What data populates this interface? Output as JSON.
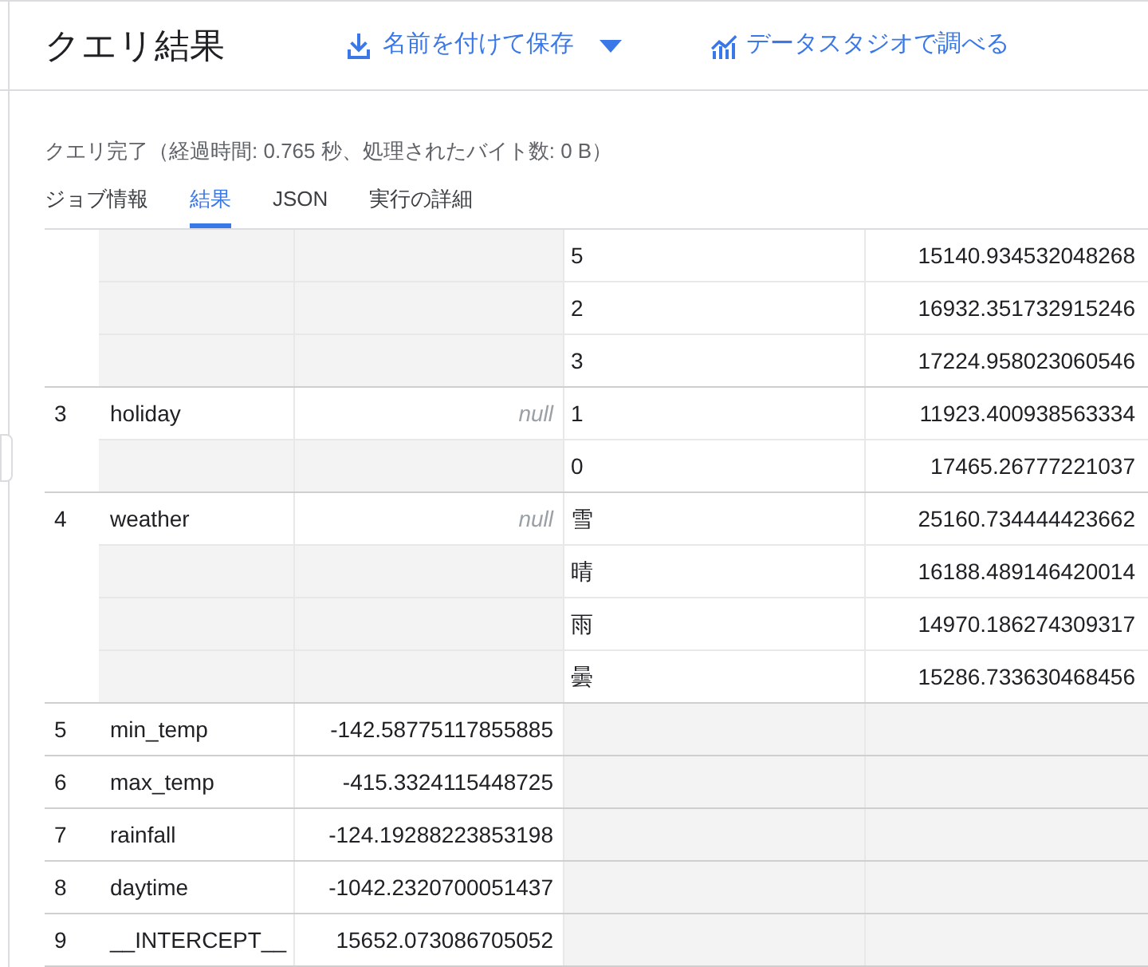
{
  "header": {
    "title": "クエリ結果",
    "save_button": "名前を付けて保存",
    "explore_button": "データスタジオで調べる"
  },
  "status": "クエリ完了（経過時間: 0.765 秒、処理されたバイト数: 0 B）",
  "tabs": [
    {
      "label": "ジョブ情報",
      "selected": false
    },
    {
      "label": "結果",
      "selected": true
    },
    {
      "label": "JSON",
      "selected": false
    },
    {
      "label": "実行の詳細",
      "selected": false
    }
  ],
  "table": {
    "groups": [
      {
        "categories": [
          {
            "category": "5",
            "weight": "15140.934532048268"
          },
          {
            "category": "2",
            "weight": "16932.351732915246"
          },
          {
            "category": "3",
            "weight": "17224.958023060546"
          }
        ]
      },
      {
        "number": "3",
        "name": "holiday",
        "value": "null",
        "value_is_null": true,
        "categories": [
          {
            "category": "1",
            "weight": "11923.400938563334"
          },
          {
            "category": "0",
            "weight": "17465.26777221037"
          }
        ]
      },
      {
        "number": "4",
        "name": "weather",
        "value": "null",
        "value_is_null": true,
        "categories": [
          {
            "category": "雪",
            "weight": "25160.734444423662"
          },
          {
            "category": "晴",
            "weight": "16188.489146420014"
          },
          {
            "category": "雨",
            "weight": "14970.186274309317"
          },
          {
            "category": "曇",
            "weight": "15286.733630468456"
          }
        ]
      },
      {
        "number": "5",
        "name": "min_temp",
        "value": "-142.58775117855885",
        "value_is_null": false
      },
      {
        "number": "6",
        "name": "max_temp",
        "value": "-415.3324115448725",
        "value_is_null": false
      },
      {
        "number": "7",
        "name": "rainfall",
        "value": "-124.19288223853198",
        "value_is_null": false
      },
      {
        "number": "8",
        "name": "daytime",
        "value": "-1042.2320700051437",
        "value_is_null": false
      },
      {
        "number": "9",
        "name": "__INTERCEPT__",
        "value": "15652.073086705052",
        "value_is_null": false
      }
    ]
  }
}
